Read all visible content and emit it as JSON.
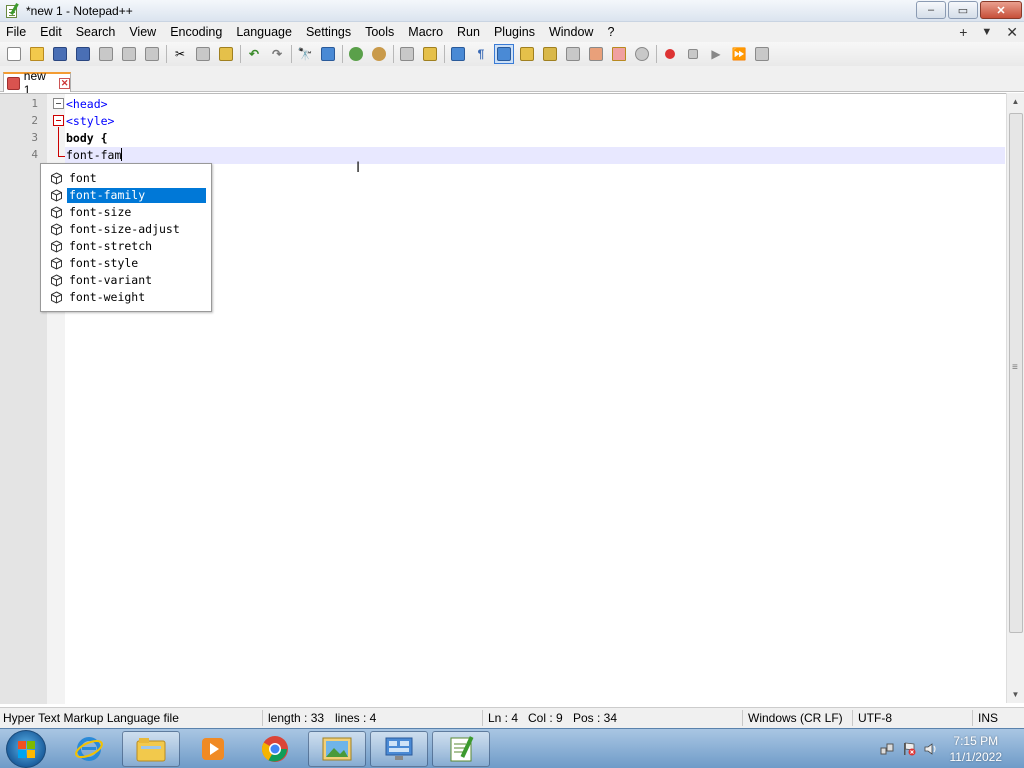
{
  "window": {
    "title": "*new 1 - Notepad++",
    "controls": {
      "minimize": "–",
      "maximize": "▭",
      "close": "✕"
    }
  },
  "menu": {
    "items": [
      "File",
      "Edit",
      "Search",
      "View",
      "Encoding",
      "Language",
      "Settings",
      "Tools",
      "Macro",
      "Run",
      "Plugins",
      "Window",
      "?"
    ],
    "right": {
      "plus": "+",
      "dropdown": "▼",
      "close": "✕"
    }
  },
  "tab": {
    "label": "new 1",
    "close": "✕"
  },
  "editor": {
    "line_numbers": [
      "1",
      "2",
      "3",
      "4"
    ],
    "lines": {
      "l1": "<head>",
      "l2": "<style>",
      "l3": "body {",
      "l4": "font-fam"
    }
  },
  "autocomplete": {
    "items": [
      "font",
      "font-family",
      "font-size",
      "font-size-adjust",
      "font-stretch",
      "font-style",
      "font-variant",
      "font-weight"
    ],
    "selected": "font-family"
  },
  "status": {
    "file_type": "Hyper Text Markup Language file",
    "length": "length : 33",
    "lines": "lines : 4",
    "ln": "Ln : 4",
    "col": "Col : 9",
    "pos": "Pos : 34",
    "eol": "Windows (CR LF)",
    "encoding": "UTF-8",
    "mode": "INS"
  },
  "taskbar": {
    "time": "7:15 PM",
    "date": "11/1/2022"
  },
  "colors": {
    "tag": "#0000ff",
    "selection": "#0078d7",
    "tab_accent": "#f39c33",
    "current_line": "#e8e8ff"
  }
}
